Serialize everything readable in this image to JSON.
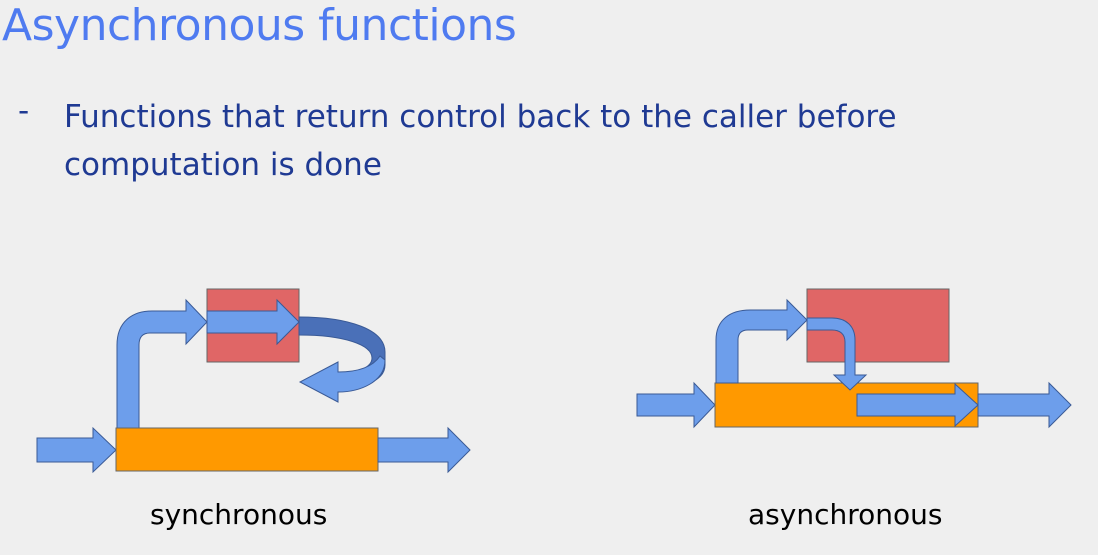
{
  "slide": {
    "title": "Asynchronous functions",
    "bullet_marker": "-",
    "bullet_text": "Functions that return control back to the caller before computation is done"
  },
  "diagrams": {
    "synchronous": {
      "caption": "synchronous"
    },
    "asynchronous": {
      "caption": "asynchronous"
    }
  },
  "colors": {
    "background": "#efefef",
    "title": "#4f7bf0",
    "bullet": "#1f3a93",
    "arrow_fill": "#6d9eeb",
    "arrow_dark": "#4a70b8",
    "caller_bar": "#ff9900",
    "callee_box": "#e06666"
  }
}
